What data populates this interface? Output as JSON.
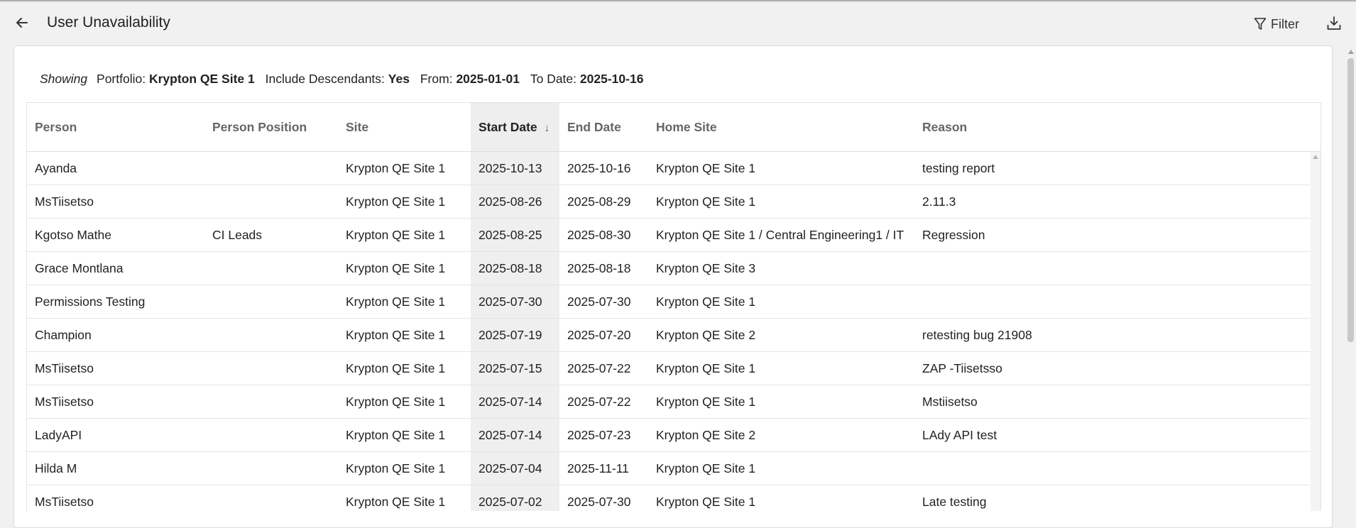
{
  "header": {
    "title": "User Unavailability",
    "filter_label": "Filter",
    "back_icon": "arrow-left-icon",
    "filter_icon": "funnel-icon",
    "download_icon": "download-icon"
  },
  "showing": {
    "prefix": "Showing",
    "portfolio_label": "Portfolio:",
    "portfolio_value": "Krypton QE Site 1",
    "descendants_label": "Include Descendants:",
    "descendants_value": "Yes",
    "from_label": "From:",
    "from_value": "2025-01-01",
    "to_label": "To Date:",
    "to_value": "2025-10-16"
  },
  "table": {
    "columns": [
      "Person",
      "Person Position",
      "Site",
      "Start Date",
      "End Date",
      "Home Site",
      "Reason"
    ],
    "sort_indicator": "↓",
    "rows": [
      [
        "Ayanda",
        "",
        "Krypton QE Site 1",
        "2025-10-13",
        "2025-10-16",
        "Krypton QE Site 1",
        "testing report"
      ],
      [
        "MsTiisetso",
        "",
        "Krypton QE Site 1",
        "2025-08-26",
        "2025-08-29",
        "Krypton QE Site 1",
        "2.11.3"
      ],
      [
        "Kgotso Mathe",
        "CI Leads",
        "Krypton QE Site 1",
        "2025-08-25",
        "2025-08-30",
        "Krypton QE Site 1 / Central Engineering1 / IT",
        "Regression"
      ],
      [
        "Grace Montlana",
        "",
        "Krypton QE Site 1",
        "2025-08-18",
        "2025-08-18",
        "Krypton QE Site 3",
        ""
      ],
      [
        "Permissions Testing",
        "",
        "Krypton QE Site 1",
        "2025-07-30",
        "2025-07-30",
        "Krypton QE Site 1",
        ""
      ],
      [
        "Champion",
        "",
        "Krypton QE Site 1",
        "2025-07-19",
        "2025-07-20",
        "Krypton QE Site 2",
        "retesting bug 21908"
      ],
      [
        "MsTiisetso",
        "",
        "Krypton QE Site 1",
        "2025-07-15",
        "2025-07-22",
        "Krypton QE Site 1",
        "ZAP -Tiisetsso"
      ],
      [
        "MsTiisetso",
        "",
        "Krypton QE Site 1",
        "2025-07-14",
        "2025-07-22",
        "Krypton QE Site 1",
        "Mstiisetso"
      ],
      [
        "LadyAPI",
        "",
        "Krypton QE Site 1",
        "2025-07-14",
        "2025-07-23",
        "Krypton QE Site 2",
        "LAdy API test"
      ],
      [
        "Hilda M",
        "",
        "Krypton QE Site 1",
        "2025-07-04",
        "2025-11-11",
        "Krypton QE Site 1",
        ""
      ],
      [
        "MsTiisetso",
        "",
        "Krypton QE Site 1",
        "2025-07-02",
        "2025-07-30",
        "Krypton QE Site 1",
        "Late testing"
      ]
    ]
  }
}
